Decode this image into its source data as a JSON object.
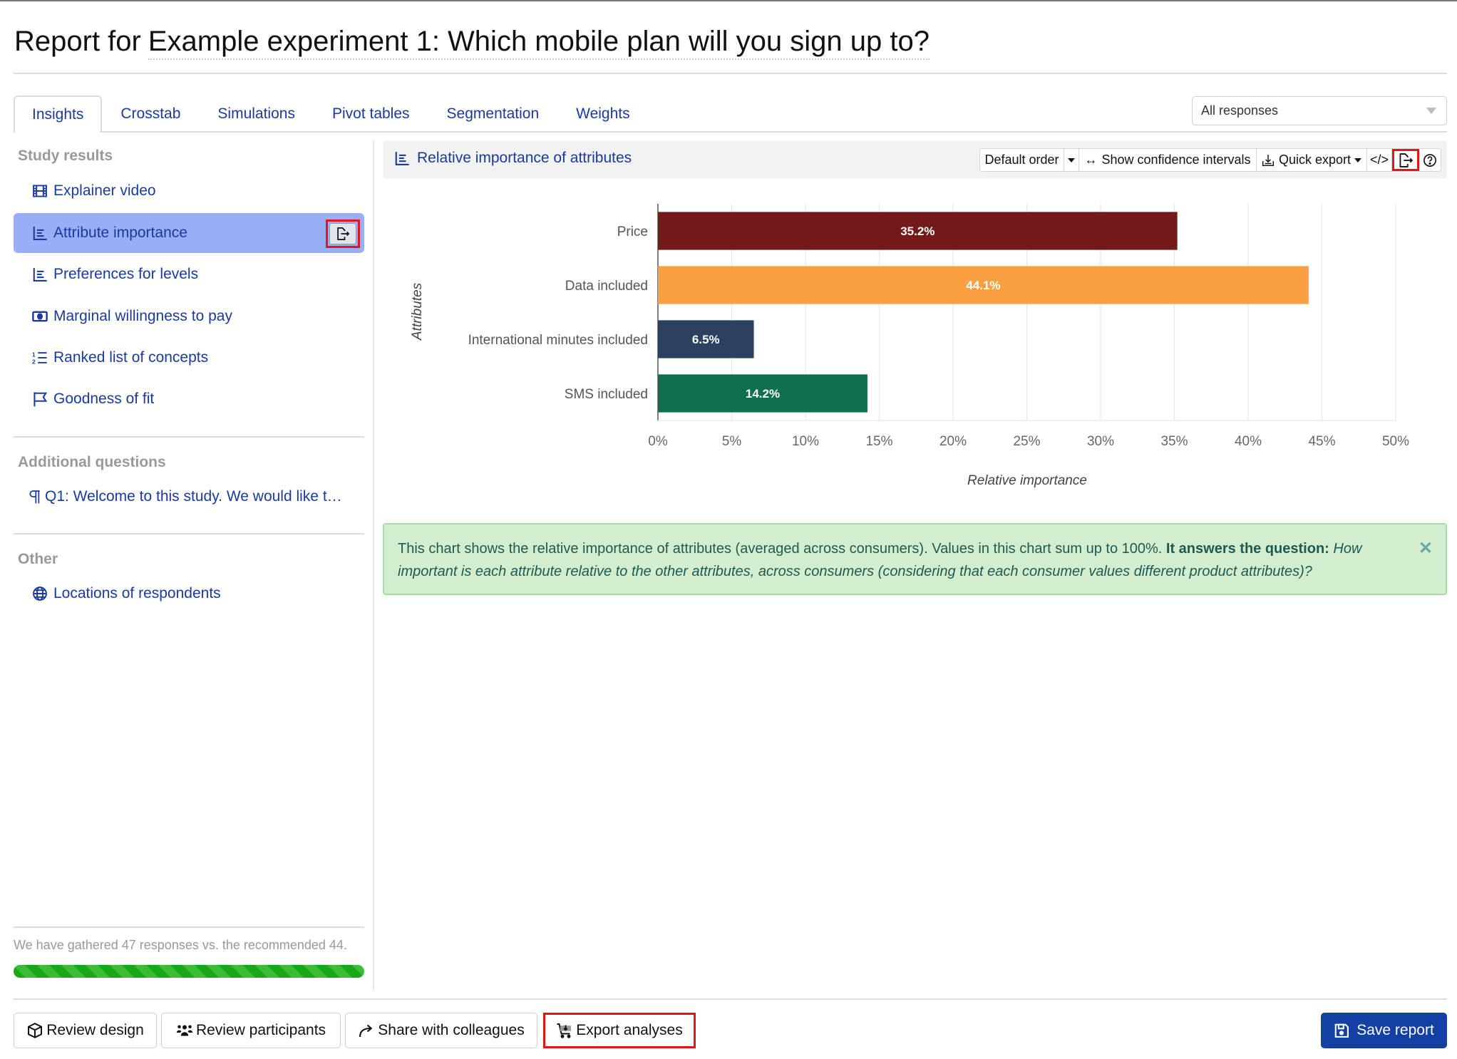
{
  "header": {
    "title_prefix": "Report for",
    "title_name": "Example experiment 1: Which mobile plan will you sign up to?"
  },
  "tabs": [
    {
      "label": "Insights",
      "active": true
    },
    {
      "label": "Crosstab",
      "active": false
    },
    {
      "label": "Simulations",
      "active": false
    },
    {
      "label": "Pivot tables",
      "active": false
    },
    {
      "label": "Segmentation",
      "active": false
    },
    {
      "label": "Weights",
      "active": false
    }
  ],
  "response_filter": {
    "selected": "All responses"
  },
  "sidebar": {
    "sections": [
      {
        "heading": "Study results",
        "items": [
          {
            "label": "Explainer video",
            "icon": "film-icon"
          },
          {
            "label": "Attribute importance",
            "icon": "bar-chart-icon",
            "active": true
          },
          {
            "label": "Preferences for levels",
            "icon": "bar-chart-icon"
          },
          {
            "label": "Marginal willingness to pay",
            "icon": "cash-icon"
          },
          {
            "label": "Ranked list of concepts",
            "icon": "ordered-list-icon"
          },
          {
            "label": "Goodness of fit",
            "icon": "flag-icon"
          }
        ]
      },
      {
        "heading": "Additional questions",
        "items": [
          {
            "label": "Q1: Welcome to this study. We would like t…",
            "icon": "paragraph-icon"
          }
        ]
      },
      {
        "heading": "Other",
        "items": [
          {
            "label": "Locations of respondents",
            "icon": "globe-icon"
          }
        ]
      }
    ],
    "responses_note": "We have gathered 47 responses vs. the recommended 44.",
    "progress_percent": 100
  },
  "panel": {
    "title": "Relative importance of attributes",
    "toolbar": {
      "order_label": "Default order",
      "confidence_label": "Show confidence intervals",
      "confidence_icon": "↔",
      "quick_export_label": "Quick export",
      "code_icon": "</>",
      "export_icon": "export-icon",
      "help_icon": "help-icon"
    }
  },
  "chart_data": {
    "type": "bar",
    "orientation": "horizontal",
    "categories": [
      "Price",
      "Data included",
      "International minutes included",
      "SMS included"
    ],
    "values": [
      35.2,
      44.1,
      6.5,
      14.2
    ],
    "value_labels": [
      "35.2%",
      "44.1%",
      "6.5%",
      "14.2%"
    ],
    "colors": [
      "#731919",
      "#f8a042",
      "#2c405f",
      "#0e6e4e"
    ],
    "xlabel": "Relative importance",
    "ylabel": "Attributes",
    "xlim": [
      0,
      50
    ],
    "xticks": [
      "0%",
      "5%",
      "10%",
      "15%",
      "20%",
      "25%",
      "30%",
      "35%",
      "40%",
      "45%",
      "50%"
    ],
    "xtick_values": [
      0,
      5,
      10,
      15,
      20,
      25,
      30,
      35,
      40,
      45,
      50
    ],
    "grid": true,
    "title": ""
  },
  "info": {
    "text": "This chart shows the relative importance of attributes (averaged across consumers). Values in this chart sum up to 100%. ",
    "bold": "It answers the question:",
    "italic": " How important is each attribute relative to the other attributes, across consumers (considering that each consumer values different product attributes)?",
    "close_icon": "✕"
  },
  "footer": {
    "review_design": "Review design",
    "review_participants": "Review participants",
    "share": "Share with colleagues",
    "export": "Export analyses",
    "save": "Save report"
  }
}
